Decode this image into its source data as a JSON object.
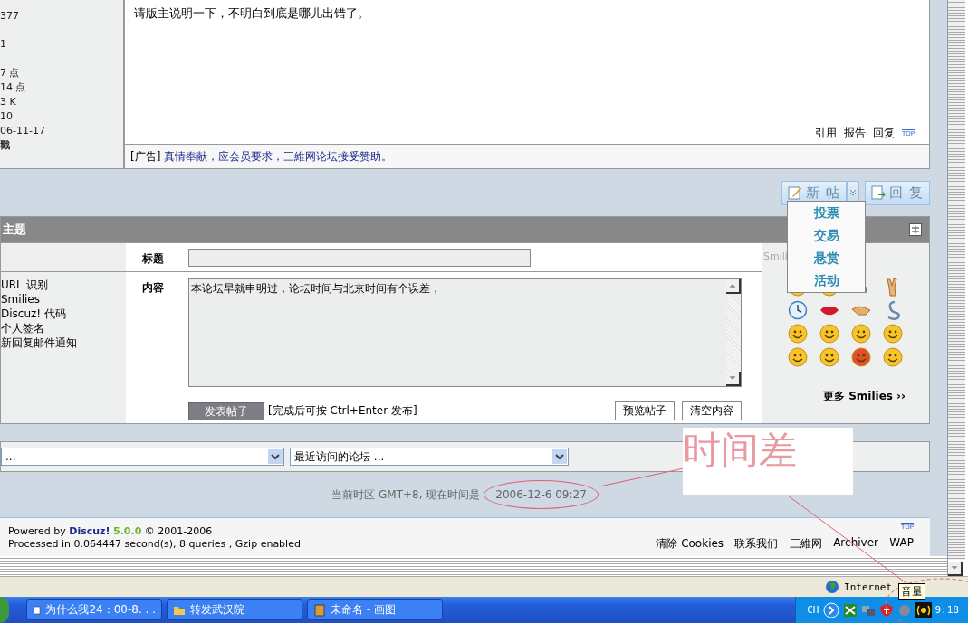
{
  "user_info": [
    "377",
    "1",
    "7 点",
    "14 点",
    "3 K",
    "10",
    "06-11-17",
    "戳"
  ],
  "post": {
    "text": "请版主说明一下，不明白到底是哪儿出错了。",
    "actions": [
      "引用",
      "报告",
      "回复"
    ],
    "top_label": "TOP"
  },
  "ad": {
    "tag": "[广告]",
    "text": "真情奉献，应会员要求，三維网论坛接受赞助。"
  },
  "buttons": [
    {
      "label": "新 帖",
      "kind": "split"
    },
    {
      "label": "回 复",
      "kind": "plain"
    }
  ],
  "new_post_menu": {
    "expanded": true,
    "items": [
      "投票",
      "交易",
      "悬赏",
      "活动"
    ]
  },
  "form": {
    "header": "主题",
    "title_label": "标题",
    "content_label": "内容",
    "content_value": "本论坛早就申明过，论坛时间与北京时间有个误差，",
    "options": [
      "URL 识别",
      "Smilies",
      "Discuz! 代码",
      "个人签名",
      "新回复邮件通知"
    ],
    "submit": "发表帖子",
    "hint": "[完成后可按  Ctrl+Enter 发布]",
    "buttons": [
      "预览帖子",
      "清空内容"
    ]
  },
  "smilies": {
    "heading": "Smili",
    "more": "更多 Smilies ››"
  },
  "jump": {
    "selects": [
      "...",
      "最近访问的论坛 ..."
    ]
  },
  "time": {
    "prefix": "当前时区 GMT+8, 现在时间是",
    "value": "2006-12-6 09:27"
  },
  "footer": {
    "powered": "Powered by",
    "brand": "Discuz!",
    "version": "5.0.0",
    "copyright": "© 2001-2006",
    "processed": "Processed in 0.064447 second(s), 8 queries , Gzip enabled",
    "top": "TOP",
    "links": [
      "清除 Cookies",
      "联系我们",
      "三維网",
      "Archiver",
      "WAP"
    ],
    "separator": "-"
  },
  "annotation": "时间差",
  "status_bar": {
    "zone": "Internet"
  },
  "tooltip": "音量",
  "taskbar": {
    "tasks": [
      {
        "label": "为什么我24：00-8. . .",
        "selected": false
      },
      {
        "label": "转发武汉院",
        "selected": false
      },
      {
        "label": "未命名 - 画图",
        "selected": false
      }
    ],
    "language": "CH",
    "clock": "9:18"
  }
}
